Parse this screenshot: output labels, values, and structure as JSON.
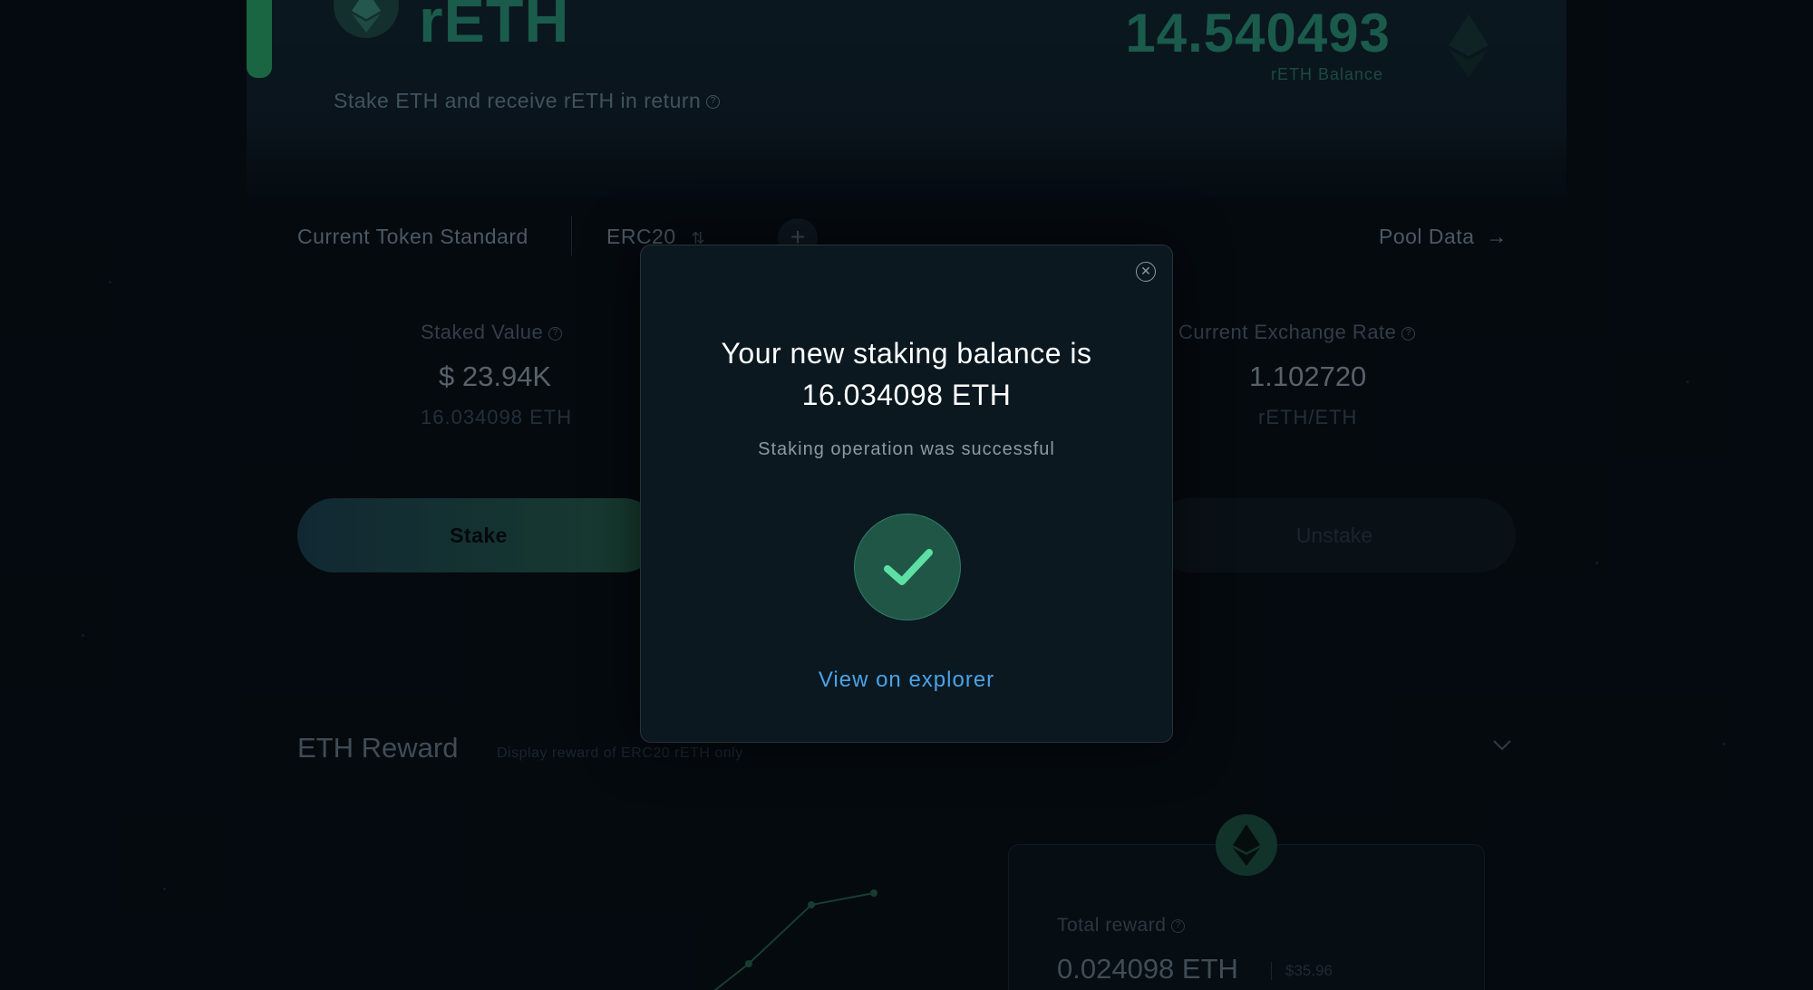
{
  "hero": {
    "title": "rETH",
    "subtitle": "Stake ETH and receive rETH in return",
    "balance": "14.540493",
    "balance_label": "rETH Balance"
  },
  "token_standard": {
    "label": "Current Token Standard",
    "value": "ERC20",
    "pool_data": "Pool Data"
  },
  "stats": {
    "staked_label": "Staked Value",
    "staked_value": "$ 23.94K",
    "staked_sub": "16.034098 ETH",
    "rate_label": "Current Exchange Rate",
    "rate_value": "1.102720",
    "rate_sub": "rETH/ETH"
  },
  "actions": {
    "stake": "Stake",
    "unstake": "Unstake"
  },
  "reward": {
    "title": "ETH Reward",
    "note": "Display reward of ERC20 rETH only",
    "total_label": "Total reward",
    "total_value": "0.024098 ETH",
    "total_usd": "$35.96"
  },
  "modal": {
    "title_line1": "Your new staking balance is",
    "title_line2": "16.034098 ETH",
    "subtitle": "Staking operation was successful",
    "link": "View on explorer",
    "close_icon": "close-icon",
    "success_icon": "check-icon"
  },
  "colors": {
    "background": "#050b11",
    "modal_bg": "#0b1820",
    "accent_green": "#5ee0a4",
    "link_blue": "#4aa3e8"
  }
}
